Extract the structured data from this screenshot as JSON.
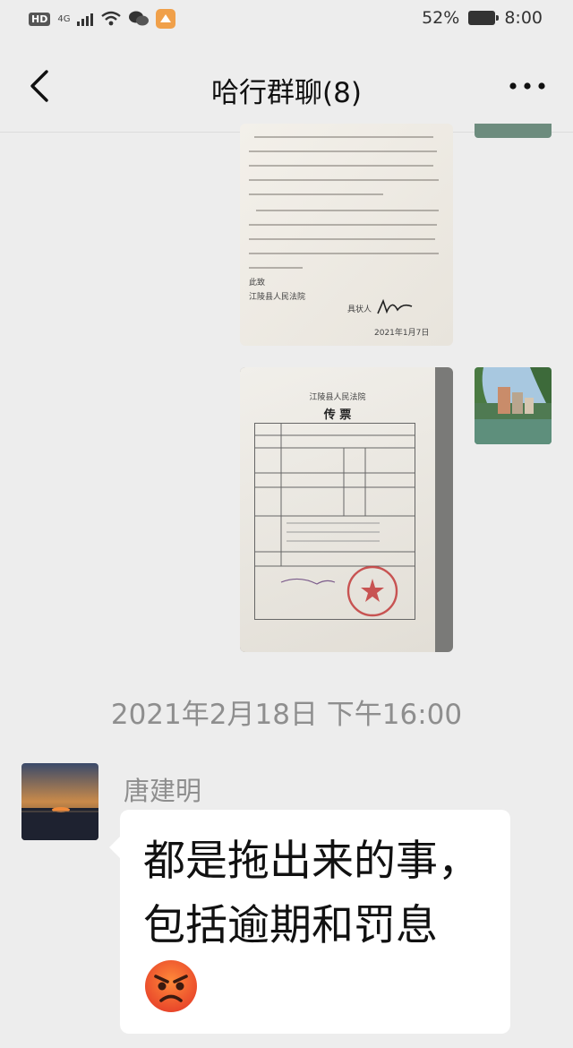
{
  "status_bar": {
    "hd": "HD",
    "network": "4G",
    "battery": "52%",
    "time": "8:00"
  },
  "nav": {
    "title": "哈行群聊(8)"
  },
  "doc1": {
    "footer_court": "江陵县人民法院",
    "sign_label": "具状人",
    "date": "2021年1月7日"
  },
  "doc2": {
    "court": "江陵县人民法院",
    "heading": "传  票"
  },
  "chat": {
    "timestamp": "2021年2月18日 下午16:00",
    "sender_name": "唐建明",
    "message_line1": "都是拖出来的事，",
    "message_line2": "包括逾期和罚息",
    "emoji": "angry-face-icon"
  },
  "colors": {
    "background": "#ededed",
    "bubble": "#ffffff",
    "meta_text": "#8e8e8e"
  }
}
